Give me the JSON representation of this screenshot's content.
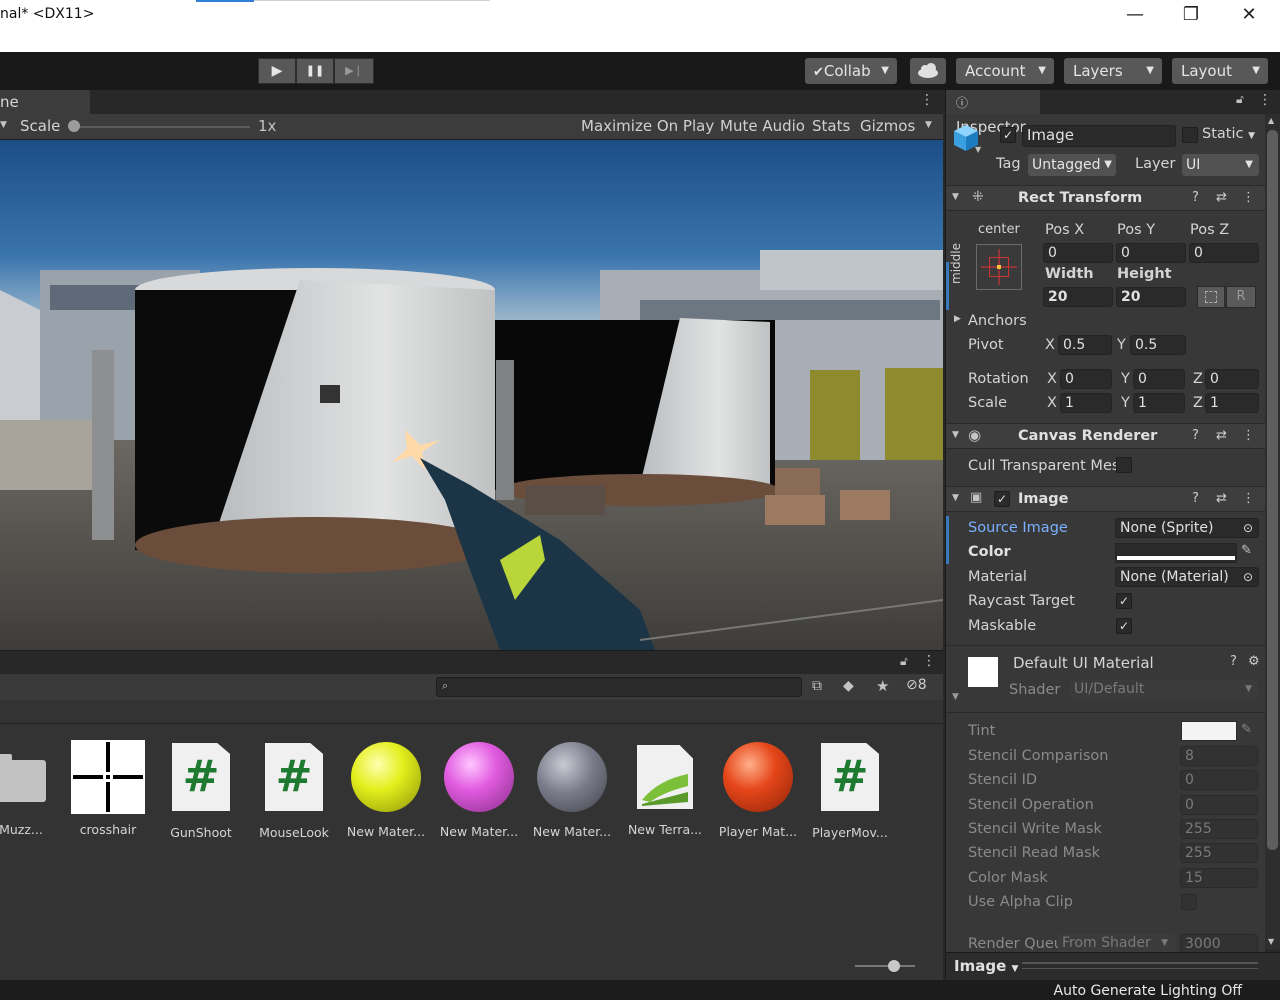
{
  "window": {
    "title": "nal* <DX11>",
    "minimize": "—",
    "maximize": "❐",
    "close": "✕"
  },
  "toolbar": {
    "play": "▶",
    "pause": "❚❚",
    "step": "▶❘",
    "collab": "Collab",
    "account": "Account",
    "layers": "Layers",
    "layout": "Layout"
  },
  "game": {
    "tab_label": "ne",
    "scale_label": "Scale",
    "scale_value": "1x",
    "maximize_on_play": "Maximize On Play",
    "mute_audio": "Mute Audio",
    "stats": "Stats",
    "gizmos": "Gizmos"
  },
  "project": {
    "hidden_count": "8",
    "assets": [
      {
        "name": "n Muzz...",
        "kind": "folder"
      },
      {
        "name": "crosshair",
        "kind": "crosshair"
      },
      {
        "name": "GunShoot",
        "kind": "script"
      },
      {
        "name": "MouseLook",
        "kind": "script"
      },
      {
        "name": "New Mater...",
        "kind": "material",
        "color": "#e3ef1c"
      },
      {
        "name": "New Mater...",
        "kind": "material",
        "color": "#e15be0"
      },
      {
        "name": "New Mater...",
        "kind": "material",
        "color": "#7a7c8a"
      },
      {
        "name": "New Terra...",
        "kind": "terrain"
      },
      {
        "name": "Player Mat...",
        "kind": "material",
        "color": "#e6461a"
      },
      {
        "name": "PlayerMov...",
        "kind": "script"
      }
    ]
  },
  "status": {
    "text": "Auto Generate Lighting Off"
  },
  "inspector": {
    "tab": "Inspector",
    "object": {
      "name": "Image",
      "static_label": "Static",
      "tag_label": "Tag",
      "tag_value": "Untagged",
      "layer_label": "Layer",
      "layer_value": "UI"
    },
    "rect_transform": {
      "title": "Rect Transform",
      "anchor_h": "center",
      "anchor_v": "middle",
      "pos_x_label": "Pos X",
      "pos_y_label": "Pos Y",
      "pos_z_label": "Pos Z",
      "pos_x": "0",
      "pos_y": "0",
      "pos_z": "0",
      "width_label": "Width",
      "height_label": "Height",
      "width": "20",
      "height": "20",
      "r_button": "R",
      "anchors_label": "Anchors",
      "pivot_label": "Pivot",
      "pivot_x": "0.5",
      "pivot_y": "0.5",
      "rotation_label": "Rotation",
      "rot_x": "0",
      "rot_y": "0",
      "rot_z": "0",
      "scale_label": "Scale",
      "scale_x": "1",
      "scale_y": "1",
      "scale_z": "1",
      "x": "X",
      "y": "Y",
      "z": "Z"
    },
    "canvas_renderer": {
      "title": "Canvas Renderer",
      "cull_label": "Cull Transparent Mes"
    },
    "image": {
      "title": "Image",
      "source_image_label": "Source Image",
      "source_image_value": "None (Sprite)",
      "color_label": "Color",
      "material_label": "Material",
      "material_value": "None (Material)",
      "raycast_label": "Raycast Target",
      "maskable_label": "Maskable"
    },
    "material": {
      "title": "Default UI Material",
      "shader_label": "Shader",
      "shader_value": "UI/Default",
      "tint_label": "Tint",
      "props": [
        {
          "label": "Stencil Comparison",
          "value": "8"
        },
        {
          "label": "Stencil ID",
          "value": "0"
        },
        {
          "label": "Stencil Operation",
          "value": "0"
        },
        {
          "label": "Stencil Write Mask",
          "value": "255"
        },
        {
          "label": "Stencil Read Mask",
          "value": "255"
        },
        {
          "label": "Color Mask",
          "value": "15"
        }
      ],
      "alpha_clip_label": "Use Alpha Clip",
      "render_queue_label": "Render Queu",
      "render_queue_mode": "From Shader",
      "render_queue_value": "3000"
    },
    "footer_label": "Image"
  },
  "colors": {
    "accent_blue": "#79b0ff",
    "panel": "#383838",
    "toolbar": "#191919"
  }
}
